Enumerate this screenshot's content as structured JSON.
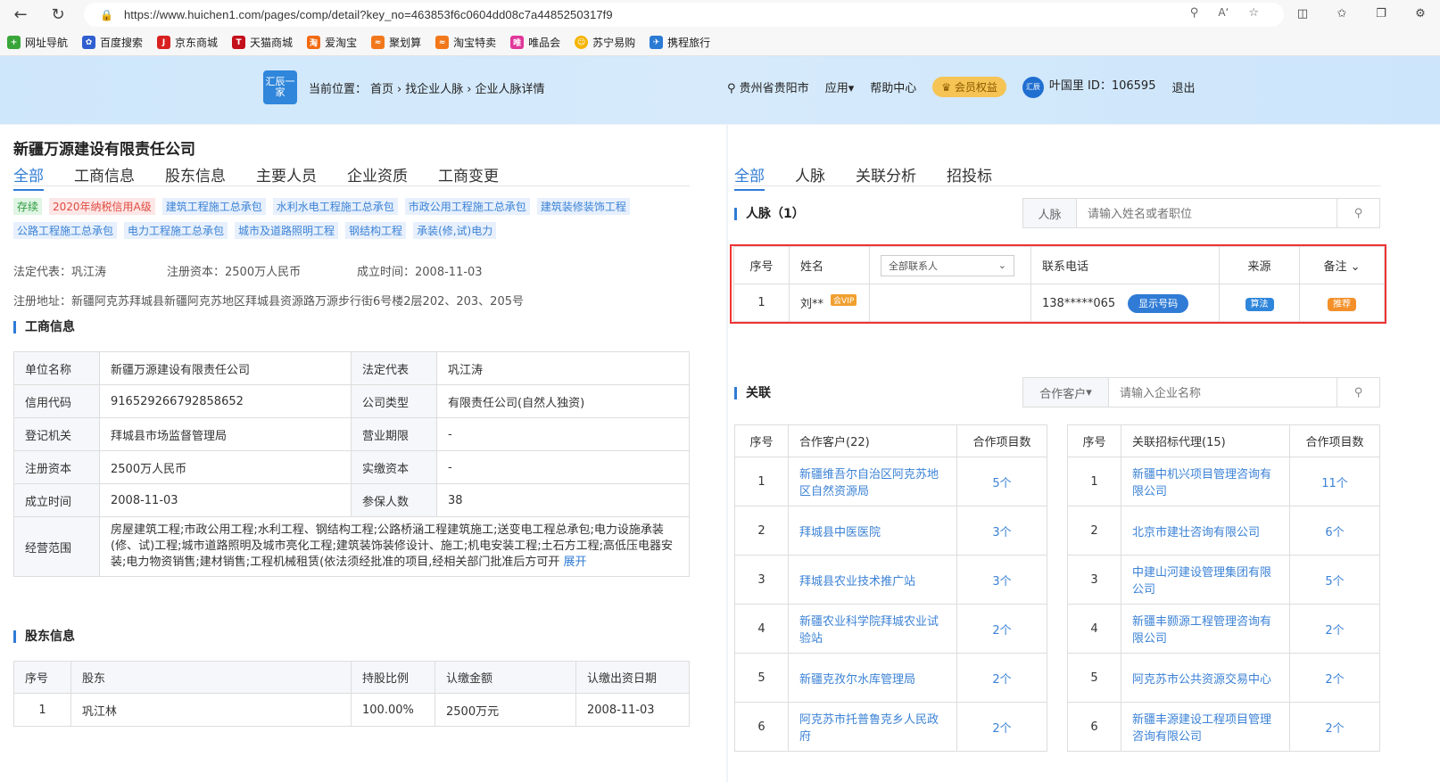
{
  "browser": {
    "url": "https://www.huichen1.com/pages/comp/detail?key_no=463853f6c0604dd08c7a4485250317f9",
    "bookmarks": [
      "网址导航",
      "百度搜索",
      "京东商城",
      "天猫商城",
      "爱淘宝",
      "聚划算",
      "淘宝特卖",
      "唯品会",
      "苏宁易购",
      "携程旅行"
    ]
  },
  "header": {
    "logo_text": "汇辰一家",
    "crumb_prefix": "当前位置：",
    "crumb": [
      "首页",
      "找企业人脉",
      "企业人脉详情"
    ],
    "location": "贵州省贵阳市",
    "apps": "应用",
    "help": "帮助中心",
    "member": "会员权益",
    "avatar_text": "汇辰",
    "user": "叶国里 ID：106595",
    "logout": "退出"
  },
  "company": {
    "name": "新疆万源建设有限责任公司",
    "tabs": [
      "全部",
      "工商信息",
      "股东信息",
      "主要人员",
      "企业资质",
      "工商变更"
    ],
    "tags": [
      {
        "text": "存续",
        "style": "green"
      },
      {
        "text": "2020年纳税信用A级",
        "style": "red"
      },
      {
        "text": "建筑工程施工总承包",
        "style": "blue"
      },
      {
        "text": "水利水电工程施工总承包",
        "style": "blue"
      },
      {
        "text": "市政公用工程施工总承包",
        "style": "blue"
      },
      {
        "text": "建筑装修装饰工程",
        "style": "blue"
      },
      {
        "text": "公路工程施工总承包",
        "style": "blue"
      },
      {
        "text": "电力工程施工总承包",
        "style": "blue"
      },
      {
        "text": "城市及道路照明工程",
        "style": "blue"
      },
      {
        "text": "钢结构工程",
        "style": "blue"
      },
      {
        "text": "承装(修,试)电力",
        "style": "blue"
      }
    ],
    "legal_rep": "法定代表：巩江涛",
    "capital": "注册资本：2500万人民币",
    "founded": "成立时间：2008-11-03",
    "address": "注册地址：新疆阿克苏拜城县新疆阿克苏地区拜城县资源路万源步行街6号楼2层202、203、205号"
  },
  "biz": {
    "title": "工商信息",
    "rows": [
      [
        "单位名称",
        "新疆万源建设有限责任公司",
        "法定代表",
        "巩江涛"
      ],
      [
        "信用代码",
        "916529266792858652",
        "公司类型",
        "有限责任公司(自然人独资)"
      ],
      [
        "登记机关",
        "拜城县市场监督管理局",
        "营业期限",
        "-"
      ],
      [
        "注册资本",
        "2500万人民币",
        "实缴资本",
        "-"
      ],
      [
        "成立时间",
        "2008-11-03",
        "参保人数",
        "38"
      ]
    ],
    "scope_label": "经营范围",
    "scope": "房屋建筑工程;市政公用工程;水利工程、钢结构工程;公路桥涵工程建筑施工;送变电工程总承包;电力设施承装(修、试)工程;城市道路照明及城市亮化工程;建筑装饰装修设计、施工;机电安装工程;土石方工程;高低压电器安装;电力物资销售;建材销售;工程机械租赁(依法须经批准的项目,经相关部门批准后方可开",
    "expand": "展开"
  },
  "shareholders": {
    "title": "股东信息",
    "headers": [
      "序号",
      "股东",
      "持股比例",
      "认缴金额",
      "认缴出资日期"
    ],
    "rows": [
      [
        "1",
        "巩江林",
        "100.00%",
        "2500万元",
        "2008-11-03"
      ]
    ]
  },
  "right": {
    "tabs": [
      "全部",
      "人脉",
      "关联分析",
      "招投标"
    ],
    "contacts_title": "人脉（1）",
    "contacts_search_prefix": "人脉",
    "contacts_search_placeholder": "请输入姓名或者职位",
    "contact_headers": {
      "no": "序号",
      "name": "姓名",
      "filter": "全部联系人",
      "phone": "联系电话",
      "source": "来源",
      "remark": "备注"
    },
    "contact_row": {
      "no": "1",
      "name": "刘**",
      "vip": "会VIP",
      "phone": "138*****065",
      "show": "显示号码",
      "source": "算法",
      "remark": "推荐"
    },
    "rel_title": "关联",
    "rel_search_prefix": "合作客户",
    "rel_search_placeholder": "请输入企业名称",
    "clients_headers": [
      "序号",
      "合作客户(22)",
      "合作项目数"
    ],
    "clients": [
      [
        "1",
        "新疆维吾尔自治区阿克苏地区自然资源局",
        "5个"
      ],
      [
        "2",
        "拜城县中医医院",
        "3个"
      ],
      [
        "3",
        "拜城县农业技术推广站",
        "3个"
      ],
      [
        "4",
        "新疆农业科学院拜城农业试验站",
        "2个"
      ],
      [
        "5",
        "新疆克孜尔水库管理局",
        "2个"
      ],
      [
        "6",
        "阿克苏市托普鲁克乡人民政府",
        "2个"
      ]
    ],
    "agents_headers": [
      "序号",
      "关联招标代理(15)",
      "合作项目数"
    ],
    "agents": [
      [
        "1",
        "新疆中机兴项目管理咨询有限公司",
        "11个"
      ],
      [
        "2",
        "北京市建壮咨询有限公司",
        "6个"
      ],
      [
        "3",
        "中建山河建设管理集团有限公司",
        "5个"
      ],
      [
        "4",
        "新疆丰颢源工程管理咨询有限公司",
        "2个"
      ],
      [
        "5",
        "阿克苏市公共资源交易中心",
        "2个"
      ],
      [
        "6",
        "新疆丰源建设工程项目管理咨询有限公司",
        "2个"
      ]
    ]
  }
}
